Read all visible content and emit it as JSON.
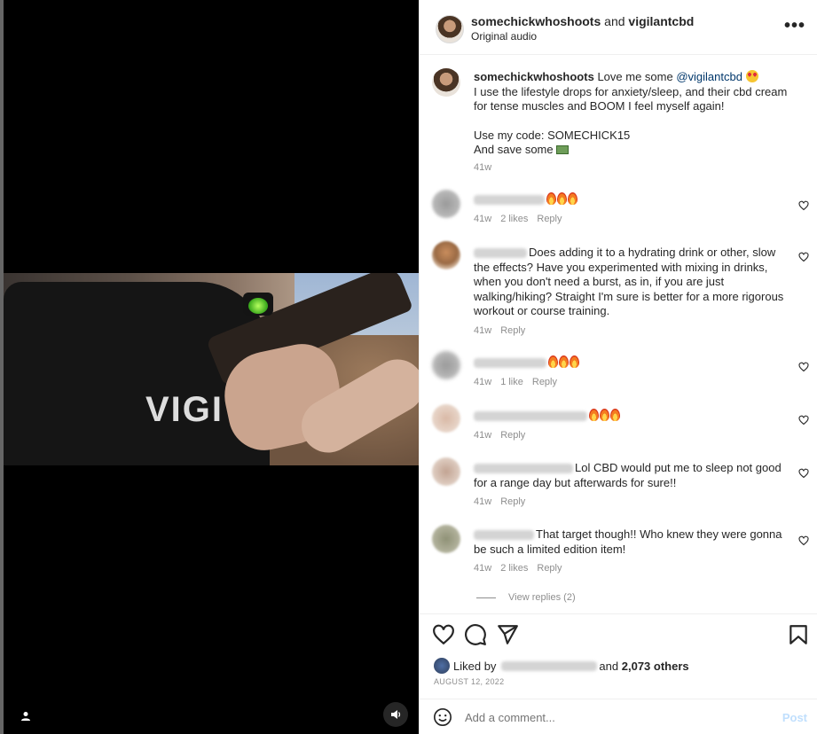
{
  "media": {
    "shirt_text": "VIGI",
    "icons": {
      "user": "user-tag-icon",
      "sound": "sound-icon"
    }
  },
  "header": {
    "owner": "somechickwhoshoots",
    "joiner": "and",
    "collab": "vigilantcbd",
    "audio": "Original audio",
    "more_icon": "•••"
  },
  "caption": {
    "username": "somechickwhoshoots",
    "text_intro": "Love me some",
    "mention": "@vigilantcbd",
    "line2": "I use the lifestyle drops for anxiety/sleep, and their cbd cream for tense muscles and BOOM I feel myself again!",
    "line3": "Use my code: SOMECHICK15",
    "line4": "And save some",
    "time": "41w"
  },
  "comments": [
    {
      "text": "",
      "time": "41w",
      "likes": "2 likes",
      "reply": "Reply",
      "fires": 3
    },
    {
      "text": "Does adding it to a hydrating drink or other, slow the effects? Have you experimented with mixing in drinks, when you don't need a burst, as in, if you are just walking/hiking? Straight I'm sure is better for a more rigorous workout or course training.",
      "time": "41w",
      "likes": "",
      "reply": "Reply",
      "fires": 0
    },
    {
      "text": "",
      "time": "41w",
      "likes": "1 like",
      "reply": "Reply",
      "fires": 3
    },
    {
      "text": "",
      "time": "41w",
      "likes": "",
      "reply": "Reply",
      "fires": 3
    },
    {
      "text": "Lol CBD would put me to sleep not good for a range day but afterwards for sure!!",
      "time": "41w",
      "likes": "",
      "reply": "Reply",
      "fires": 0
    },
    {
      "text": "That target though!! Who knew they were gonna be such a limited edition item!",
      "time": "41w",
      "likes": "2 likes",
      "reply": "Reply",
      "fires": 0
    }
  ],
  "view_replies": "View replies (2)",
  "likes": {
    "prefix": "Liked by",
    "suffix_and": "and",
    "count": "2,073 others"
  },
  "date": "AUGUST 12, 2022",
  "add_comment": {
    "placeholder": "Add a comment...",
    "post": "Post"
  }
}
